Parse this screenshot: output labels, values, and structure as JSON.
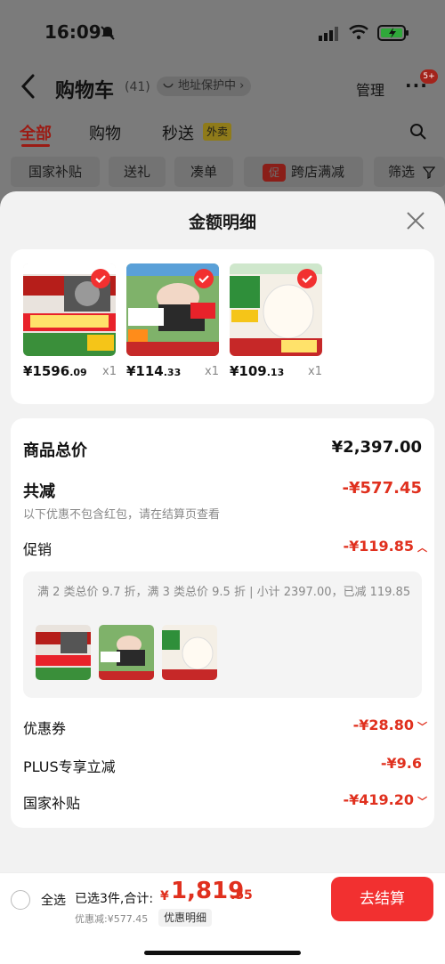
{
  "status_bar": {
    "time": "16:09"
  },
  "nav": {
    "title": "购物车",
    "count": "(41)",
    "address_protect": "地址保护中 ›",
    "manage": "管理",
    "more": "···",
    "badge": "5+"
  },
  "tabs": [
    {
      "label": "全部"
    },
    {
      "label": "购物"
    },
    {
      "label": "秒送"
    }
  ],
  "tab_tag": "外卖",
  "filters": [
    {
      "label": "国家补贴"
    },
    {
      "label": "送礼"
    },
    {
      "label": "凑单"
    },
    {
      "label": "跨店满减"
    },
    {
      "label": "筛选"
    }
  ],
  "promo_mark": "促",
  "sheet": {
    "title": "金额明细"
  },
  "products": [
    {
      "price_int": "¥1596",
      "price_dec": ".09",
      "qty": "x1"
    },
    {
      "price_int": "¥114",
      "price_dec": ".33",
      "qty": "x1"
    },
    {
      "price_int": "¥109",
      "price_dec": ".13",
      "qty": "x1"
    }
  ],
  "summary": {
    "total_label": "商品总价",
    "total_value": "¥2,397.00",
    "reduce_label": "共减",
    "reduce_value": "-¥577.45",
    "note": "以下优惠不包含红包，请在结算页查看",
    "promo_label": "促销",
    "promo_value": "-¥119.85",
    "promo_detail": "满 2 类总价 9.7 折，满 3 类总价 9.5 折 | 小计 2397.00，已减 119.85",
    "coupon_label": "优惠券",
    "coupon_value": "-¥28.80",
    "plus_label": "PLUS专享立减",
    "plus_value": "-¥9.6",
    "subsidy_label": "国家补贴",
    "subsidy_value": "-¥419.20"
  },
  "footer": {
    "select_all": "全选",
    "selected": "已选3件,合计:",
    "total_sym": "¥",
    "total_int": "1,819",
    "total_dec": ".55",
    "discount": "优惠减:¥577.45",
    "detail_btn": "优惠明细",
    "checkout": "去结算"
  },
  "colors": {
    "accent": "#f23030",
    "red_text": "#e0301e",
    "overlay": "#7b7b7b"
  }
}
